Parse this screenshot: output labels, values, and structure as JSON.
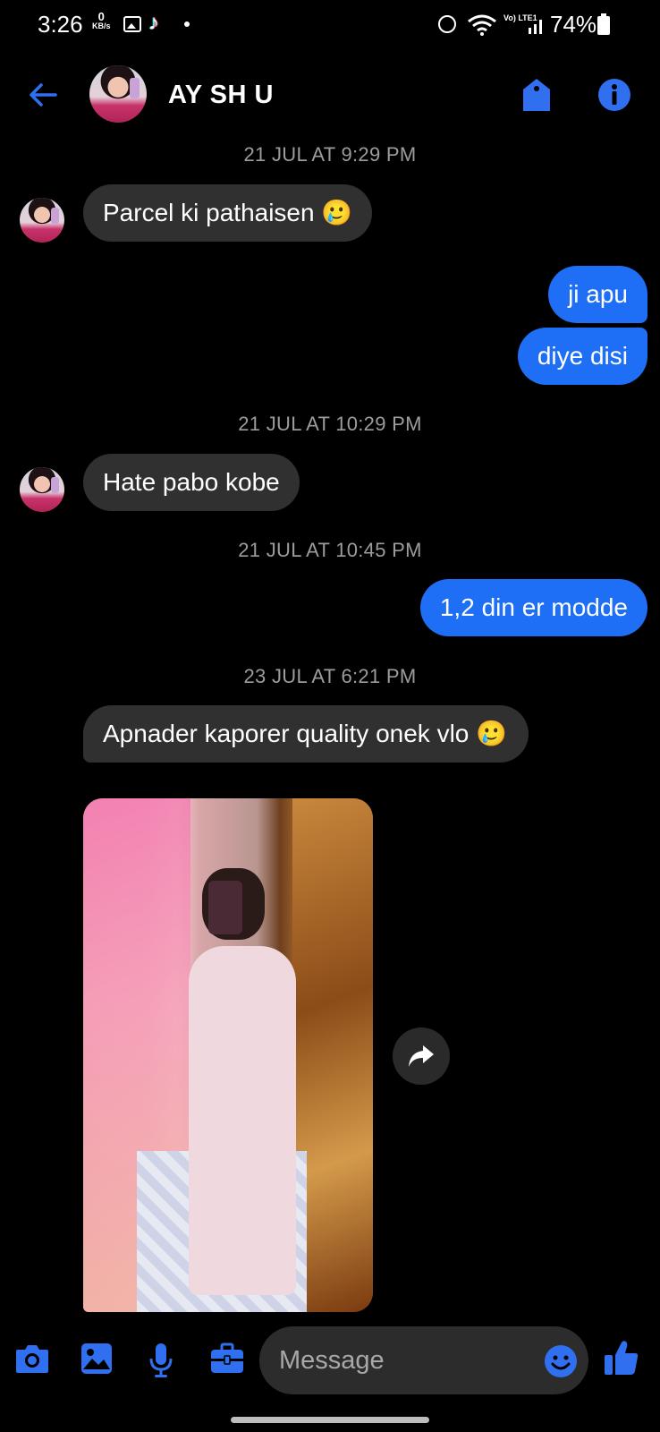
{
  "status_bar": {
    "time": "3:26",
    "net_speed_value": "0",
    "net_speed_unit": "KB/s",
    "volte": "Vo) LTE1",
    "battery": "74%"
  },
  "header": {
    "contact_name": "AY SH U",
    "accent": "#1e6ff5"
  },
  "timestamps": [
    "21 JUL AT 9:29 PM",
    "21 JUL AT 10:29 PM",
    "21 JUL AT 10:45 PM",
    "23 JUL AT 6:21 PM"
  ],
  "messages": [
    {
      "from": "them",
      "text": "Parcel ki pathaisen",
      "emoji": "🥲"
    },
    {
      "from": "me",
      "text": "ji apu"
    },
    {
      "from": "me",
      "text": "diye disi"
    },
    {
      "from": "them",
      "text": "Hate pabo kobe"
    },
    {
      "from": "me",
      "text": "1,2 din er modde"
    },
    {
      "from": "them",
      "text": "Apnader kaporer quality onek vlo",
      "emoji": "🥲"
    }
  ],
  "composer": {
    "placeholder": "Message"
  },
  "colors": {
    "outgoing_bubble": "#1e6ff5",
    "incoming_bubble": "#303030",
    "icon_blue": "#2f6ff0"
  }
}
